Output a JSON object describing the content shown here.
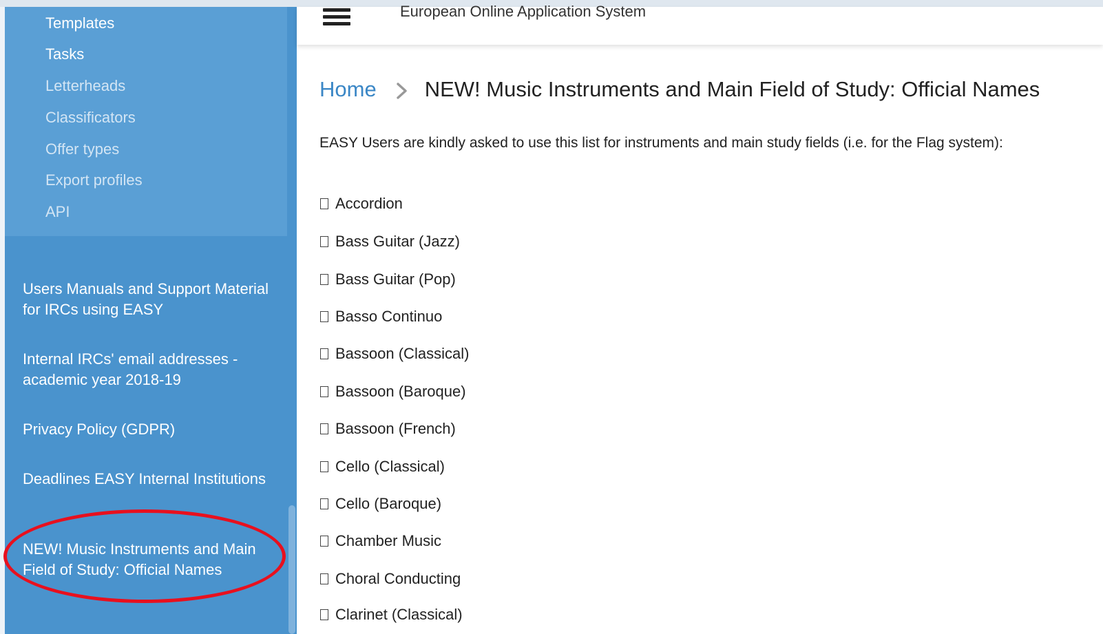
{
  "sidebar": {
    "sub_items": [
      {
        "label": "Templates"
      },
      {
        "label": "Tasks"
      },
      {
        "label": "Letterheads"
      },
      {
        "label": "Classificators"
      },
      {
        "label": "Offer types"
      },
      {
        "label": "Export profiles"
      },
      {
        "label": "API"
      }
    ],
    "links": [
      {
        "label": "Users Manuals and Support Material for IRCs using EASY"
      },
      {
        "label": "Internal IRCs' email addresses - academic year 2018-19"
      },
      {
        "label": "Privacy Policy (GDPR)"
      },
      {
        "label": "Deadlines EASY Internal Institutions"
      },
      {
        "label": "NEW! Music Instruments and Main Field of Study: Official Names"
      }
    ],
    "highlight_color": "#e8101e"
  },
  "header": {
    "title": "European Online Application System",
    "menu_icon": "hamburger-icon"
  },
  "breadcrumb": {
    "home": "Home",
    "separator_icon": "chevron-right-icon",
    "current": "NEW! Music Instruments and Main Field of Study: Official Names"
  },
  "main": {
    "intro": "EASY Users are kindly asked to use this list for instruments and main study fields (i.e. for the Flag system):",
    "items": [
      "Accordion",
      "Bass Guitar (Jazz)",
      "Bass Guitar (Pop)",
      "Basso Continuo",
      "Bassoon (Classical)",
      "Bassoon (Baroque)",
      "Bassoon (French)",
      "Cello (Classical)",
      "Cello (Baroque)",
      "Chamber Music",
      "Choral Conducting",
      "Clarinet (Classical)"
    ]
  },
  "colors": {
    "sidebar": "#4a93cd",
    "sidebar_sub": "#5a9fd5",
    "link": "#3b87c6"
  }
}
